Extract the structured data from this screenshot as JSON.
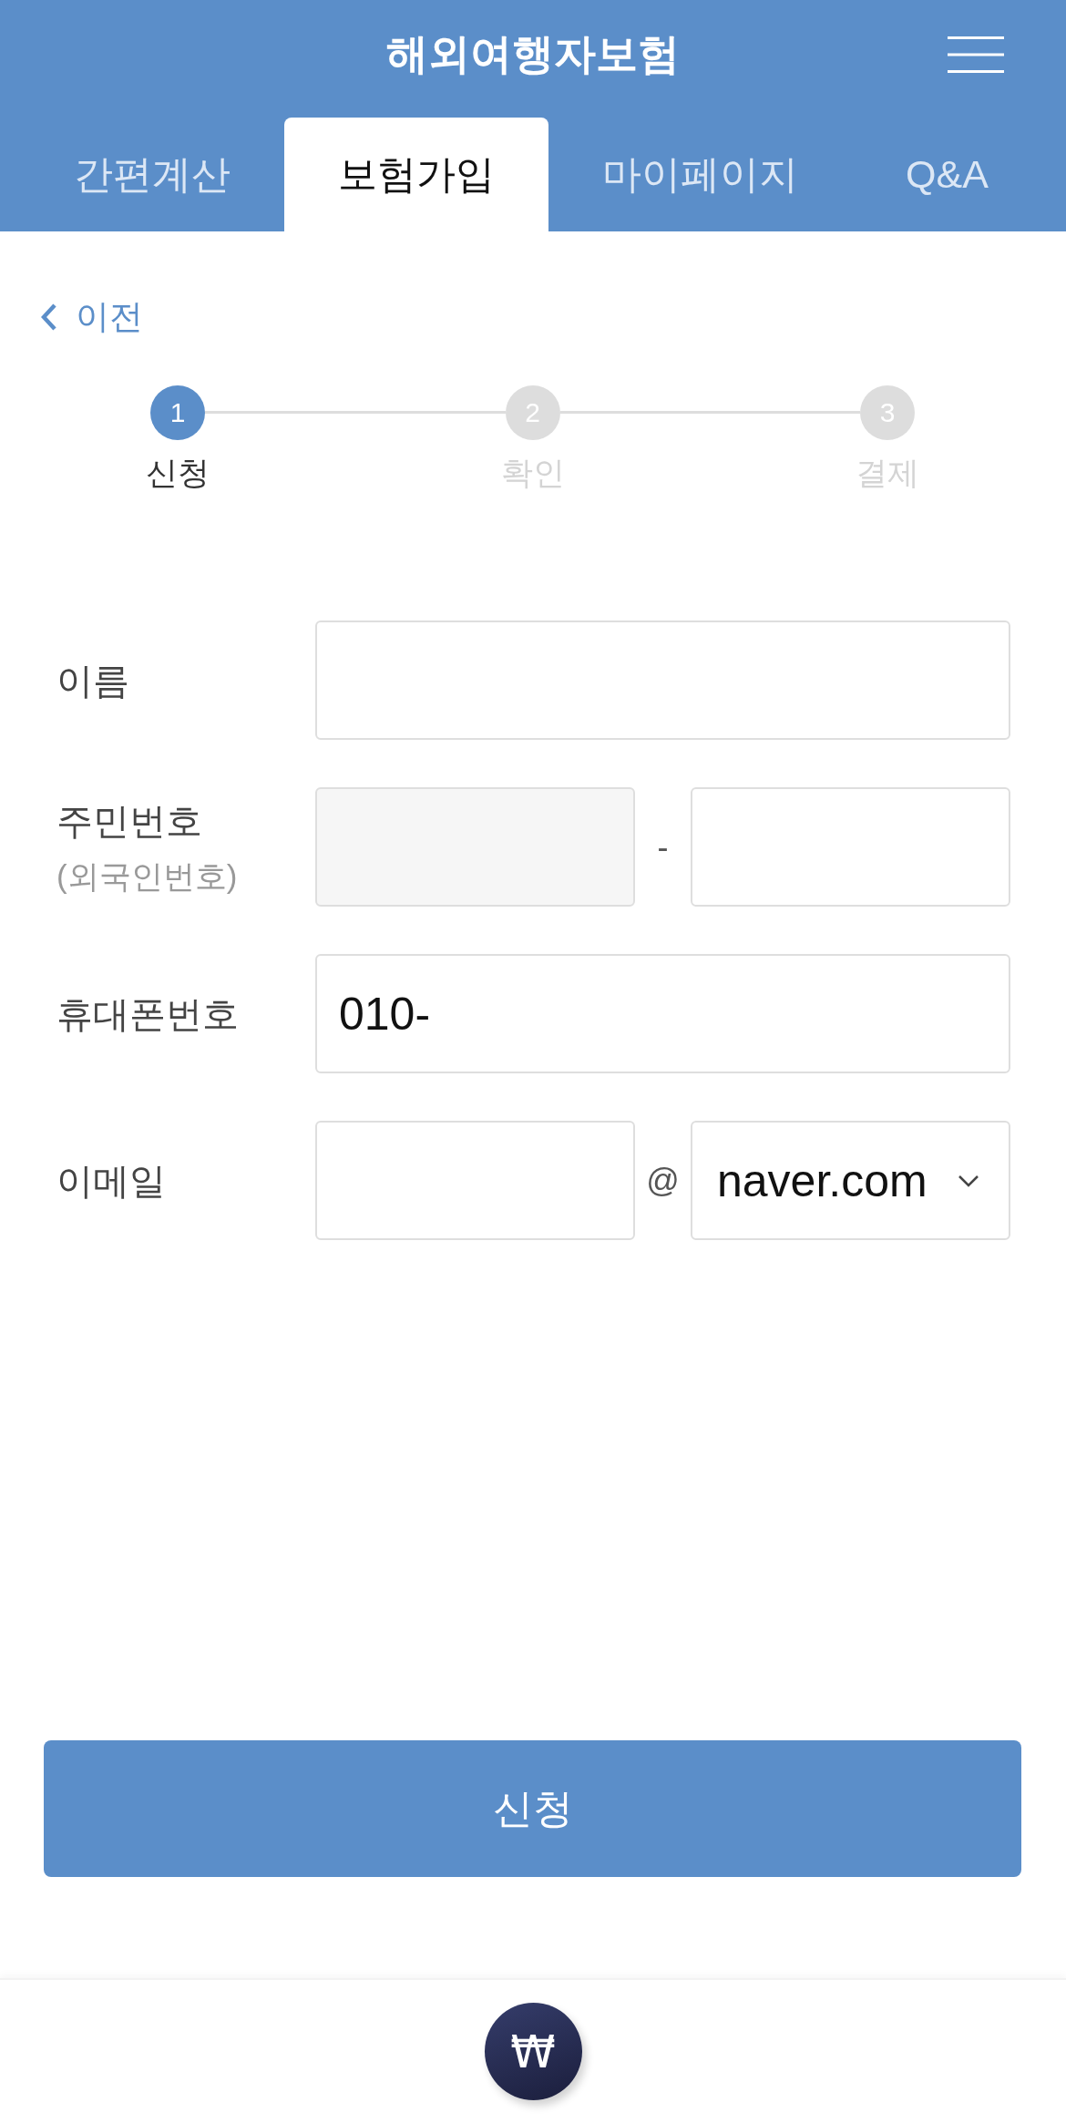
{
  "header": {
    "title": "해외여행자보험"
  },
  "tabs": [
    {
      "label": "간편계산",
      "selected": false
    },
    {
      "label": "보험가입",
      "selected": true
    },
    {
      "label": "마이페이지",
      "selected": false
    },
    {
      "label": "Q&A",
      "selected": false
    }
  ],
  "back_link": {
    "label": "이전"
  },
  "steps": [
    {
      "number": "1",
      "label": "신청",
      "active": true
    },
    {
      "number": "2",
      "label": "확인",
      "active": false
    },
    {
      "number": "3",
      "label": "결제",
      "active": false
    }
  ],
  "form": {
    "rows": [
      {
        "label": "이름",
        "fields": [
          {
            "kind": "input"
          }
        ]
      },
      {
        "label": "주민번호",
        "sublabel": "(외국인번호)",
        "fields": [
          {
            "kind": "readonly"
          },
          {
            "kind": "separator",
            "text": "-"
          },
          {
            "kind": "input"
          }
        ]
      },
      {
        "label": "휴대폰번호",
        "fields": [
          {
            "kind": "input",
            "value": "010-"
          }
        ]
      },
      {
        "label": "이메일",
        "fields": [
          {
            "kind": "input"
          },
          {
            "kind": "separator",
            "text": "@"
          },
          {
            "kind": "select",
            "value": "naver.com"
          }
        ]
      }
    ]
  },
  "submit_button": {
    "label": "신청"
  },
  "bottom_bar": {
    "button_symbol": "₩"
  }
}
